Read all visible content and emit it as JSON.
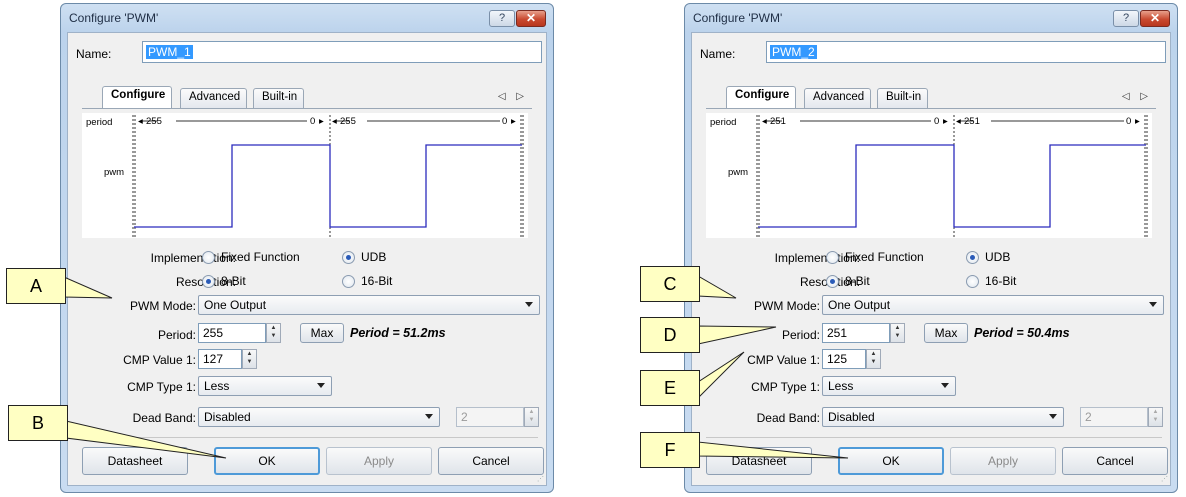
{
  "dialogs": [
    {
      "title": "Configure 'PWM'",
      "help_glyph": "?",
      "close_glyph": "✕",
      "name_label": "Name:",
      "name_value": "PWM_1",
      "tabs": [
        "Configure",
        "Advanced",
        "Built-in"
      ],
      "tab_scroll": "◁ ▷",
      "waveform": {
        "period_label": "period",
        "pwm_label": "pwm",
        "count_start": "255",
        "count_end": "0",
        "trace_color": "#2b2bbd"
      },
      "implementation": {
        "label": "Implementation:",
        "options": [
          "Fixed Function",
          "UDB"
        ],
        "selected": "UDB"
      },
      "resolution": {
        "label": "Resolution:",
        "options": [
          "8-Bit",
          "16-Bit"
        ],
        "selected": "8-Bit"
      },
      "pwm_mode": {
        "label": "PWM Mode:",
        "value": "One Output"
      },
      "period": {
        "label": "Period:",
        "value": "255",
        "max_button": "Max",
        "computed": "Period = 51.2ms"
      },
      "cmp_value_1": {
        "label": "CMP Value 1:",
        "value": "127"
      },
      "cmp_type_1": {
        "label": "CMP Type 1:",
        "value": "Less"
      },
      "dead_band": {
        "label": "Dead Band:",
        "value": "Disabled",
        "count": "2"
      },
      "buttons": {
        "datasheet": "Datasheet",
        "ok": "OK",
        "apply": "Apply",
        "cancel": "Cancel"
      }
    },
    {
      "title": "Configure 'PWM'",
      "help_glyph": "?",
      "close_glyph": "✕",
      "name_label": "Name:",
      "name_value": "PWM_2",
      "tabs": [
        "Configure",
        "Advanced",
        "Built-in"
      ],
      "tab_scroll": "◁ ▷",
      "waveform": {
        "period_label": "period",
        "pwm_label": "pwm",
        "count_start": "251",
        "count_end": "0",
        "trace_color": "#2b2bbd"
      },
      "implementation": {
        "label": "Implementation:",
        "options": [
          "Fixed Function",
          "UDB"
        ],
        "selected": "UDB"
      },
      "resolution": {
        "label": "Resolution:",
        "options": [
          "8-Bit",
          "16-Bit"
        ],
        "selected": "8-Bit"
      },
      "pwm_mode": {
        "label": "PWM Mode:",
        "value": "One Output"
      },
      "period": {
        "label": "Period:",
        "value": "251",
        "max_button": "Max",
        "computed": "Period = 50.4ms"
      },
      "cmp_value_1": {
        "label": "CMP Value 1:",
        "value": "125"
      },
      "cmp_type_1": {
        "label": "CMP Type 1:",
        "value": "Less"
      },
      "dead_band": {
        "label": "Dead Band:",
        "value": "Disabled",
        "count": "2"
      },
      "buttons": {
        "datasheet": "Datasheet",
        "ok": "OK",
        "apply": "Apply",
        "cancel": "Cancel"
      }
    }
  ],
  "callouts": {
    "a": "A",
    "b": "B",
    "c": "C",
    "d": "D",
    "e": "E",
    "f": "F"
  },
  "colors": {
    "callout_fill": "#ffffc3",
    "titlebar": "#bcd3ec",
    "default_button_border": "#4e9ad8"
  }
}
